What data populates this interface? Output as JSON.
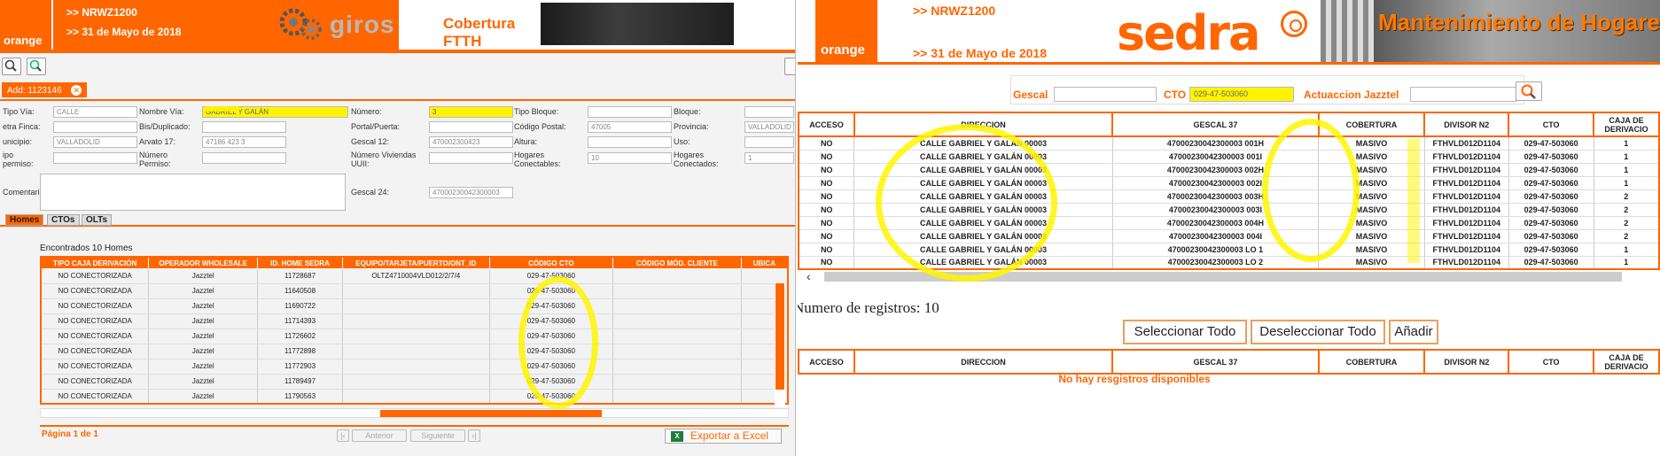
{
  "left": {
    "logo": "orange",
    "header_line1": ">> NRWZ1200",
    "header_line2": ">> 31 de Mayo de 2018",
    "brand": "giros",
    "section_title": "Cobertura FTTH",
    "toolbar_icons": [
      "search-icon",
      "zoom-icon"
    ],
    "add_tab": {
      "label": "Add: 1123146",
      "close_glyph": "✕"
    },
    "form": {
      "tipo_via": {
        "label": "Tipo Vía:",
        "value": "CALLE"
      },
      "nombre_via": {
        "label": "Nombre Vía:",
        "value": "GABRIEL Y GALÁN"
      },
      "numero": {
        "label": "Número:",
        "value": "3"
      },
      "tipo_bloque": {
        "label": "Tipo Bloque:",
        "value": ""
      },
      "bloque": {
        "label": "Bloque:",
        "value": ""
      },
      "letra_finca": {
        "label": "etra Finca:",
        "value": ""
      },
      "bis_duplicado": {
        "label": "Bis/Duplicado:",
        "value": ""
      },
      "portal_puerta": {
        "label": "Portal/Puerta:",
        "value": ""
      },
      "codigo_postal": {
        "label": "Código Postal:",
        "value": "47005"
      },
      "provincia": {
        "label": "Provincia:",
        "value": "VALLADOLID"
      },
      "municipio": {
        "label": "unicipio:",
        "value": "VALLADOLID"
      },
      "arvato": {
        "label": "Arvato 17:",
        "value": "47186  423    3"
      },
      "gescal12": {
        "label": "Gescal 12:",
        "value": "470002300423"
      },
      "altura": {
        "label": "Altura:",
        "value": ""
      },
      "uso": {
        "label": "Uso:",
        "value": ""
      },
      "tipo_permiso": {
        "label": "ipo\npermiso:",
        "value": ""
      },
      "numero_permiso": {
        "label": "Número\nPermiso:",
        "value": ""
      },
      "num_viviendas": {
        "label": "Número Viviendas\nUUII:",
        "value": ""
      },
      "hogares_conectables": {
        "label": "Hogares\nConectables:",
        "value": "10"
      },
      "hogares_conectados": {
        "label": "Hogares\nConectados:",
        "value": "1"
      },
      "comentario": {
        "label": "Comentario:"
      },
      "gescal24": {
        "label": "Gescal 24:",
        "value": "47000230042300003"
      }
    },
    "subtabs": [
      "Homes",
      "CTOs",
      "OLTs"
    ],
    "found_text": "Encontrados 10 Homes",
    "grid": {
      "columns": [
        "TIPO CAJA DERIVACIÓN",
        "OPERADOR WHOLESALE",
        "ID. HOME SEDRA",
        "EQUIPO/TARJETA/PUERTO/ONT_ID",
        "CÓDIGO CTO",
        "CÓDIGO MÓD. CLIENTE",
        "UBICA"
      ],
      "rows": [
        [
          "NO CONECTORIZADA",
          "Jazztel",
          "11728687",
          "OLTZ4710004VLD012/2/7/4",
          "029-47-503060",
          "",
          ""
        ],
        [
          "NO CONECTORIZADA",
          "Jazztel",
          "11640508",
          "",
          "029-47-503060",
          "",
          ""
        ],
        [
          "NO CONECTORIZADA",
          "Jazztel",
          "11690722",
          "",
          "029-47-503060",
          "",
          ""
        ],
        [
          "NO CONECTORIZADA",
          "Jazztel",
          "11714393",
          "",
          "029-47-503060",
          "",
          ""
        ],
        [
          "NO CONECTORIZADA",
          "Jazztel",
          "11726602",
          "",
          "029-47-503060",
          "",
          ""
        ],
        [
          "NO CONECTORIZADA",
          "Jazztel",
          "11772898",
          "",
          "029-47-503060",
          "",
          ""
        ],
        [
          "NO CONECTORIZADA",
          "Jazztel",
          "11772903",
          "",
          "029-47-503060",
          "",
          ""
        ],
        [
          "NO CONECTORIZADA",
          "Jazztel",
          "11789497",
          "",
          "029-47-503060",
          "",
          ""
        ],
        [
          "NO CONECTORIZADA",
          "Jazztel",
          "11790563",
          "",
          "029-47-503060",
          "",
          ""
        ]
      ]
    },
    "pagination": {
      "label": "Página 1 de 1",
      "prev": "Anterior",
      "next": "Siguiente"
    },
    "export_label": "Exportar a Excel"
  },
  "right": {
    "logo": "orange",
    "header_line1": ">> NRWZ1200",
    "header_line2": ">> 31 de Mayo de 2018",
    "brand": "sedra",
    "section_title": "Mantenimiento de Hogares",
    "search": {
      "gescal_label": "Gescal",
      "gescal_value": "",
      "cto_label": "CTO",
      "cto_value": "029-47-503060",
      "jazztel_label": "Actuaccion Jazztel",
      "jazztel_value": ""
    },
    "grid": {
      "columns": [
        "ACCESO",
        "DIRECCION",
        "GESCAL 37",
        "COBERTURA",
        "DIVISOR N2",
        "CTO",
        "CAJA DE DERIVACIO"
      ],
      "rows": [
        [
          "NO",
          "CALLE GABRIEL Y GALÁN 00003",
          "47000230042300003 001H",
          "MASIVO",
          "FTHVLD012D1104",
          "029-47-503060",
          "1"
        ],
        [
          "NO",
          "CALLE GABRIEL Y GALÁN 00003",
          "47000230042300003 001I",
          "MASIVO",
          "FTHVLD012D1104",
          "029-47-503060",
          "1"
        ],
        [
          "NO",
          "CALLE GABRIEL Y GALÁN 00003",
          "47000230042300003 002H",
          "MASIVO",
          "FTHVLD012D1104",
          "029-47-503060",
          "1"
        ],
        [
          "NO",
          "CALLE GABRIEL Y GALÁN 00003",
          "47000230042300003 002I",
          "MASIVO",
          "FTHVLD012D1104",
          "029-47-503060",
          "1"
        ],
        [
          "NO",
          "CALLE GABRIEL Y GALÁN 00003",
          "47000230042300003 003H",
          "MASIVO",
          "FTHVLD012D1104",
          "029-47-503060",
          "2"
        ],
        [
          "NO",
          "CALLE GABRIEL Y GALÁN 00003",
          "47000230042300003 003I",
          "MASIVO",
          "FTHVLD012D1104",
          "029-47-503060",
          "2"
        ],
        [
          "NO",
          "CALLE GABRIEL Y GALÁN 00003",
          "47000230042300003 004H",
          "MASIVO",
          "FTHVLD012D1104",
          "029-47-503060",
          "2"
        ],
        [
          "NO",
          "CALLE GABRIEL Y GALÁN 00003",
          "47000230042300003 004I",
          "MASIVO",
          "FTHVLD012D1104",
          "029-47-503060",
          "2"
        ],
        [
          "NO",
          "CALLE GABRIEL Y GALÁN 00003",
          "47000230042300003 LO 1",
          "MASIVO",
          "FTHVLD012D1104",
          "029-47-503060",
          "1"
        ],
        [
          "NO",
          "CALLE GABRIEL Y GALÁN 00003",
          "47000230042300003 LO 2",
          "MASIVO",
          "FTHVLD012D1104",
          "029-47-503060",
          "1"
        ]
      ]
    },
    "num_registros": "Numero de registros: 10",
    "buttons": {
      "select_all": "Seleccionar Todo",
      "deselect_all": "Deseleccionar Todo",
      "add": "Añadir"
    },
    "second_grid_columns": [
      "ACCESO",
      "DIRECCION",
      "GESCAL 37",
      "COBERTURA",
      "DIVISOR N2",
      "CTO",
      "CAJA DE DERIVACIO"
    ],
    "no_records": "No hay resgistros disponibles"
  },
  "colors": {
    "accent": "#ff6600",
    "highlight": "#fff400"
  }
}
